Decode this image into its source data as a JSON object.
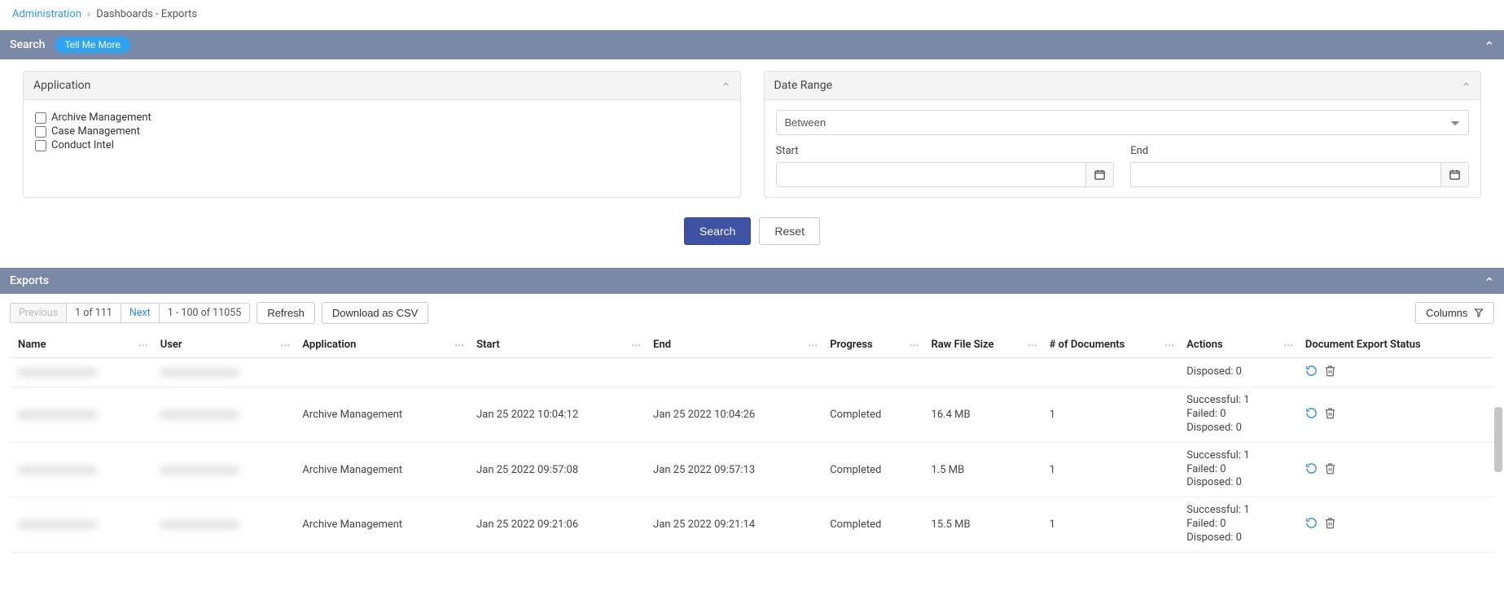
{
  "breadcrumb": {
    "root": "Administration",
    "sep": "›",
    "current": "Dashboards - Exports"
  },
  "search_section": {
    "title": "Search",
    "tell_me_more": "Tell Me More",
    "application_panel": {
      "title": "Application",
      "options": [
        "Archive Management",
        "Case Management",
        "Conduct Intel"
      ]
    },
    "date_panel": {
      "title": "Date Range",
      "mode": "Between",
      "start_label": "Start",
      "end_label": "End"
    },
    "search_btn": "Search",
    "reset_btn": "Reset"
  },
  "exports_section": {
    "title": "Exports",
    "pager": {
      "prev": "Previous",
      "pages": "1 of 111",
      "next": "Next",
      "range": "1 - 100 of 11055"
    },
    "refresh": "Refresh",
    "download_csv": "Download as CSV",
    "columns_btn": "Columns",
    "headers": [
      "Name",
      "User",
      "Application",
      "Start",
      "End",
      "Progress",
      "Raw File Size",
      "# of Documents",
      "Actions",
      "Document Export Status"
    ],
    "rows": [
      {
        "name": "redacted",
        "user": "redacted",
        "application": "",
        "start": "",
        "end": "",
        "progress": "",
        "raw_size": "",
        "docs": "",
        "status_successful": "",
        "status_failed": "",
        "status_disposed": "Disposed: 0",
        "partial": true
      },
      {
        "name": "redacted",
        "user": "redacted",
        "application": "Archive Management",
        "start": "Jan 25 2022 10:04:12",
        "end": "Jan 25 2022 10:04:26",
        "progress": "Completed",
        "raw_size": "16.4 MB",
        "docs": "1",
        "status_successful": "Successful: 1",
        "status_failed": "Failed: 0",
        "status_disposed": "Disposed: 0"
      },
      {
        "name": "redacted",
        "user": "redacted",
        "application": "Archive Management",
        "start": "Jan 25 2022 09:57:08",
        "end": "Jan 25 2022 09:57:13",
        "progress": "Completed",
        "raw_size": "1.5 MB",
        "docs": "1",
        "status_successful": "Successful: 1",
        "status_failed": "Failed: 0",
        "status_disposed": "Disposed: 0"
      },
      {
        "name": "redacted",
        "user": "redacted",
        "application": "Archive Management",
        "start": "Jan 25 2022 09:21:06",
        "end": "Jan 25 2022 09:21:14",
        "progress": "Completed",
        "raw_size": "15.5 MB",
        "docs": "1",
        "status_successful": "Successful: 1",
        "status_failed": "Failed: 0",
        "status_disposed": "Disposed: 0"
      }
    ]
  }
}
